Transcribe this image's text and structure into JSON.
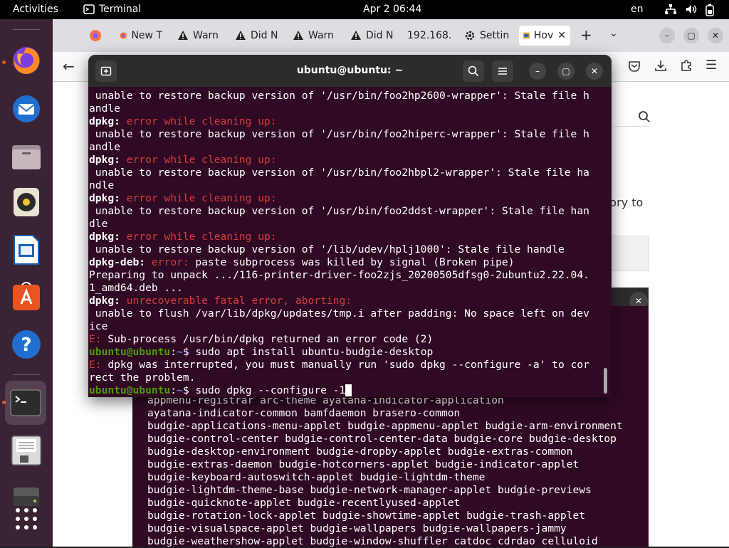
{
  "topbar": {
    "activities": "Activities",
    "app_name": "Terminal",
    "clock": "Apr 2  06:44",
    "lang": "en"
  },
  "dock": {
    "items": [
      "firefox-icon",
      "thunderbird-icon",
      "files-icon",
      "rhythmbox-icon",
      "libreoffice-writer-icon",
      "app-center-icon",
      "help-icon",
      "terminal-icon",
      "floppy-icon",
      "drive-icon",
      "show-apps-icon"
    ]
  },
  "browser": {
    "tabs": [
      {
        "label": "New T",
        "icon": "firefox-icon"
      },
      {
        "label": "Warn",
        "icon": "warning-icon"
      },
      {
        "label": "Did N",
        "icon": "warning-icon"
      },
      {
        "label": "Warn",
        "icon": "warning-icon"
      },
      {
        "label": "Did N",
        "icon": "warning-icon"
      },
      {
        "label": "192.168.",
        "icon": ""
      },
      {
        "label": "Settin",
        "icon": "gear-icon"
      },
      {
        "label": "Hov",
        "icon": "site-icon"
      }
    ],
    "page_snippets": [
      "e",
      "o",
      "tory to"
    ]
  },
  "terminal": {
    "title": "ubuntu@ubuntu: ~",
    "lines": [
      [
        {
          "t": " unable to restore backup version of '/usr/bin/foo2hp2600-wrapper': Stale file h"
        }
      ],
      [
        {
          "t": "andle"
        }
      ],
      [
        {
          "t": "dpkg:",
          "c": "bold"
        },
        {
          "t": " error while cleaning up:",
          "c": "err"
        }
      ],
      [
        {
          "t": " unable to restore backup version of '/usr/bin/foo2hiperc-wrapper': Stale file h"
        }
      ],
      [
        {
          "t": "andle"
        }
      ],
      [
        {
          "t": "dpkg:",
          "c": "bold"
        },
        {
          "t": " error while cleaning up:",
          "c": "err"
        }
      ],
      [
        {
          "t": " unable to restore backup version of '/usr/bin/foo2hbpl2-wrapper': Stale file ha"
        }
      ],
      [
        {
          "t": "ndle"
        }
      ],
      [
        {
          "t": "dpkg:",
          "c": "bold"
        },
        {
          "t": " error while cleaning up:",
          "c": "err"
        }
      ],
      [
        {
          "t": " unable to restore backup version of '/usr/bin/foo2ddst-wrapper': Stale file han"
        }
      ],
      [
        {
          "t": "dle"
        }
      ],
      [
        {
          "t": "dpkg:",
          "c": "bold"
        },
        {
          "t": " error while cleaning up:",
          "c": "err"
        }
      ],
      [
        {
          "t": " unable to restore backup version of '/lib/udev/hplj1000': Stale file handle"
        }
      ],
      [
        {
          "t": "dpkg-deb:",
          "c": "bold"
        },
        {
          "t": " error:",
          "c": "red"
        },
        {
          "t": " paste subprocess was killed by signal (Broken pipe)"
        }
      ],
      [
        {
          "t": "Preparing to unpack .../116-printer-driver-foo2zjs_20200505dfsg0-2ubuntu2.22.04."
        }
      ],
      [
        {
          "t": "1_amd64.deb ..."
        }
      ],
      [
        {
          "t": "dpkg:",
          "c": "bold"
        },
        {
          "t": " unrecoverable fatal error, aborting:",
          "c": "err"
        }
      ],
      [
        {
          "t": " unable to flush /var/lib/dpkg/updates/tmp.i after padding: No space left on dev"
        }
      ],
      [
        {
          "t": "ice"
        }
      ],
      [
        {
          "t": "E:",
          "c": "red"
        },
        {
          "t": " Sub-process /usr/bin/dpkg returned an error code (2)"
        }
      ],
      [
        {
          "t": "ubuntu@ubuntu",
          "c": "prompt-user"
        },
        {
          "t": ":"
        },
        {
          "t": "~",
          "c": "prompt-path"
        },
        {
          "t": "$ sudo apt install ubuntu-budgie-desktop"
        }
      ],
      [
        {
          "t": "E:",
          "c": "red"
        },
        {
          "t": " dpkg was interrupted, you must manually run 'sudo dpkg --configure -a' to cor"
        }
      ],
      [
        {
          "t": "rect the problem."
        }
      ],
      [
        {
          "t": "ubuntu@ubuntu",
          "c": "prompt-user"
        },
        {
          "t": ":"
        },
        {
          "t": "~",
          "c": "prompt-path"
        },
        {
          "t": "$ sudo dpkg --configure -1"
        },
        {
          "t": " ",
          "c": "cursor"
        }
      ]
    ]
  },
  "background_terminal": {
    "lines": [
      "appmenu-registrar arc-theme ayatana-indicator-application",
      "ayatana-indicator-common bamfdaemon brasero-common",
      "budgie-applications-menu-applet budgie-appmenu-applet budgie-arm-environment",
      "budgie-control-center budgie-control-center-data budgie-core budgie-desktop",
      "budgie-desktop-environment budgie-dropby-applet budgie-extras-common",
      "budgie-extras-daemon budgie-hotcorners-applet budgie-indicator-applet",
      "budgie-keyboard-autoswitch-applet budgie-lightdm-theme",
      "budgie-lightdm-theme-base budgie-network-manager-applet budgie-previews",
      "budgie-quicknote-applet budgie-recentlyused-applet",
      "budgie-rotation-lock-applet budgie-showtime-applet budgie-trash-applet",
      "budgie-visualspace-applet budgie-wallpapers budgie-wallpapers-jammy",
      "budgie-weathershow-applet budgie-window-shuffler catdoc cdrdao celluloid"
    ]
  }
}
